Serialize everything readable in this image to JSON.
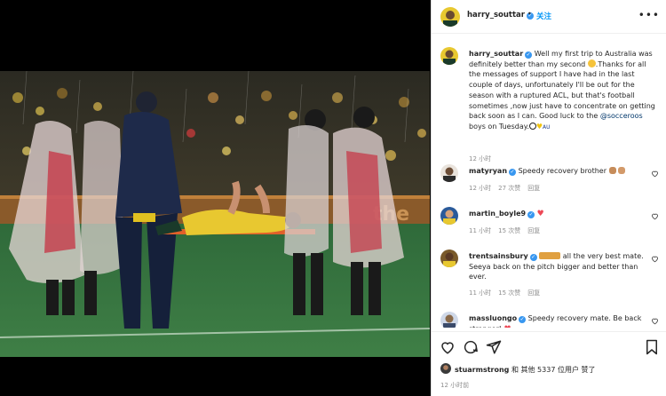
{
  "post": {
    "username": "harry_souttar",
    "follow_label": "关注",
    "separator": "•",
    "more_icon": "more-horizontal-icon"
  },
  "caption": {
    "username": "harry_souttar",
    "text_before_emoji": "Well my first trip to Australia was definitely better than my second",
    "text_after_emoji": ".Thanks for all the messages of support I have had in the last couple of days, unfortunately I'll be out for the season with a ruptured ACL, but that's football sometimes ,now just have to concentrate on getting back soon as I can. Good luck to the",
    "mention": "@socceroos",
    "text_end": "boys on Tuesday.",
    "flag_text": "AU",
    "time": "12 小时"
  },
  "comments": [
    {
      "username": "matyryan",
      "text": "Speedy recovery brother",
      "time": "12 小时",
      "likes": "27 次赞",
      "reply": "回复"
    },
    {
      "username": "martin_boyle9",
      "text": "",
      "time": "11 小时",
      "likes": "15 次赞",
      "reply": "回复"
    },
    {
      "username": "trentsainsbury",
      "text": "all the very best mate. Seeya back on the pitch bigger and better than ever.",
      "time": "11 小时",
      "likes": "15 次赞",
      "reply": "回复"
    },
    {
      "username": "massluongo",
      "text": "Speedy recovery mate. Be back stronger!",
      "time": "",
      "likes": "",
      "reply": ""
    }
  ],
  "liked_by": {
    "username": "stuarmstrong",
    "text": "和 其他 5337 位用户 赞了"
  },
  "post_time": "12 小时前",
  "colors": {
    "link_blue": "#0095f6",
    "verified_blue": "#3897f0",
    "heart_red": "#ed4956",
    "muted_gray": "#8e8e8e"
  },
  "icons": [
    "heart-icon",
    "comment-icon",
    "share-icon",
    "bookmark-icon",
    "verified-icon"
  ]
}
